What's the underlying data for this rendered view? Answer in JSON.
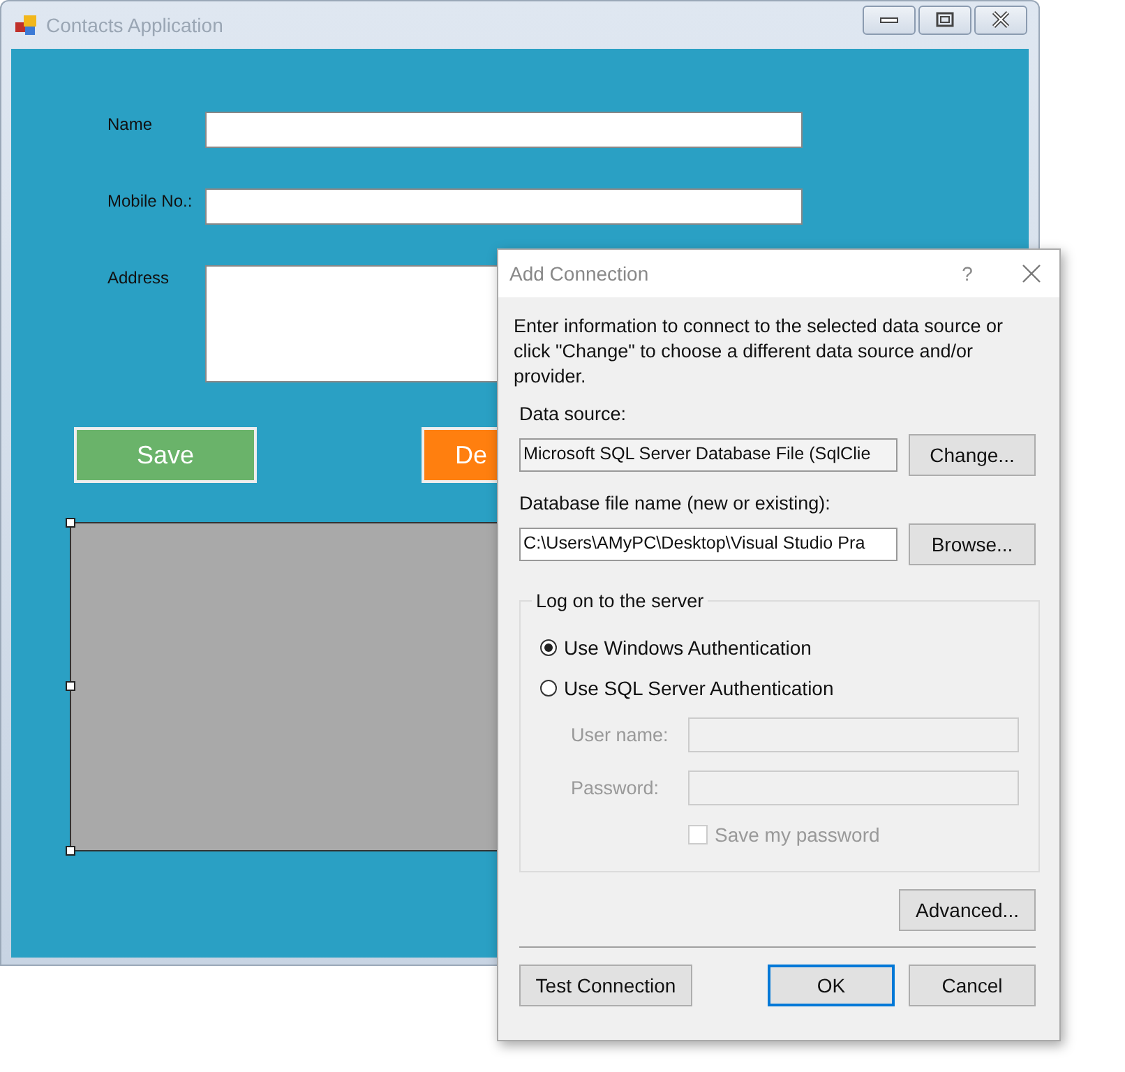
{
  "window": {
    "title": "Contacts Application"
  },
  "form": {
    "fields": [
      {
        "label": "Name",
        "kind": "line"
      },
      {
        "label": "Mobile No.:",
        "kind": "line"
      },
      {
        "label": "Address",
        "kind": "multiline"
      }
    ],
    "buttons": [
      {
        "label": "Save",
        "kind": "save"
      },
      {
        "label": "De",
        "kind": "delete"
      }
    ]
  },
  "dialog": {
    "title": "Add Connection",
    "help": "?",
    "intro": "Enter information to connect to the selected data source or click \"Change\" to choose a different data source and/or provider.",
    "data_source": {
      "label": "Data source:",
      "value": "Microsoft SQL Server Database File (SqlClie",
      "button": "Change..."
    },
    "database_file": {
      "label": "Database file name (new or existing):",
      "value": "C:\\Users\\AMyPC\\Desktop\\Visual Studio Pra",
      "button": "Browse..."
    },
    "logon": {
      "legend": "Log on to the server",
      "options": [
        {
          "label": "Use Windows Authentication",
          "selected": true
        },
        {
          "label": "Use SQL Server Authentication",
          "selected": false
        }
      ],
      "user_name": {
        "label": "User name:",
        "disabled": true
      },
      "password": {
        "label": "Password:",
        "disabled": true
      },
      "save_password": {
        "label": "Save my password",
        "checked": false,
        "disabled": true
      }
    },
    "advanced": "Advanced...",
    "test": "Test Connection",
    "ok": "OK",
    "cancel": "Cancel"
  }
}
